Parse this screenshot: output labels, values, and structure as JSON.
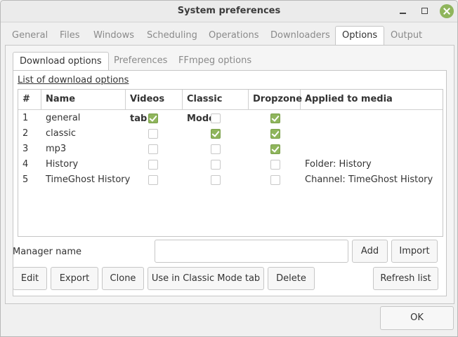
{
  "window": {
    "title": "System preferences"
  },
  "tabs": [
    "General",
    "Files",
    "Windows",
    "Scheduling",
    "Operations",
    "Downloaders",
    "Options",
    "Output"
  ],
  "active_tab": "Options",
  "subtabs": [
    "Download options",
    "Preferences",
    "FFmpeg options"
  ],
  "active_subtab": "Download options",
  "list_label": "List of download options",
  "table": {
    "columns": [
      "#",
      "Name",
      "Videos tab",
      "Classic Mode",
      "Dropzone",
      "Applied to media"
    ],
    "rows": [
      {
        "num": "1",
        "name": "general",
        "videos_tab": true,
        "classic_mode": false,
        "dropzone": true,
        "applied": ""
      },
      {
        "num": "2",
        "name": "classic",
        "videos_tab": false,
        "classic_mode": true,
        "dropzone": true,
        "applied": ""
      },
      {
        "num": "3",
        "name": "mp3",
        "videos_tab": false,
        "classic_mode": false,
        "dropzone": true,
        "applied": ""
      },
      {
        "num": "4",
        "name": "History",
        "videos_tab": false,
        "classic_mode": false,
        "dropzone": false,
        "applied": "Folder: History"
      },
      {
        "num": "5",
        "name": "TimeGhost History",
        "videos_tab": false,
        "classic_mode": false,
        "dropzone": false,
        "applied": "Channel: TimeGhost History"
      }
    ]
  },
  "manager": {
    "label": "Manager name",
    "value": "",
    "placeholder": ""
  },
  "buttons": {
    "add": "Add",
    "import": "Import",
    "edit": "Edit",
    "export": "Export",
    "clone": "Clone",
    "use_classic": "Use in Classic Mode tab",
    "delete": "Delete",
    "refresh": "Refresh list",
    "ok": "OK"
  },
  "colors": {
    "accent": "#8fb55c",
    "background": "#f0f0f0",
    "border": "#c6c6c6"
  }
}
